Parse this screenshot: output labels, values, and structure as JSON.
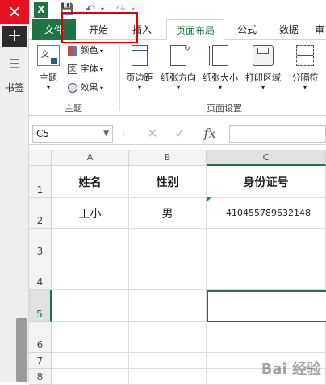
{
  "sidebar": {
    "close": "✕",
    "plus": "+",
    "menu": "☰",
    "bookmark": "书签"
  },
  "qat": {
    "excel": "X",
    "save": "💾",
    "undo": "↶",
    "redo": "↷"
  },
  "tabs": {
    "file": "文件",
    "home": "开始",
    "insert": "插入",
    "page_layout": "页面布局",
    "formulas": "公式",
    "data": "数据",
    "review": "审"
  },
  "ribbon": {
    "theme": "主题",
    "colors": "颜色",
    "fonts": "字体",
    "effects": "效果",
    "margins": "页边距",
    "orientation": "纸张方向",
    "size": "纸张大小",
    "print_area": "打印区域",
    "breaks": "分隔符",
    "group_theme": "主题",
    "group_page_setup": "页面设置"
  },
  "formula_bar": {
    "name_box": "C5",
    "cancel": "✕",
    "enter": "✓",
    "fx": "fx"
  },
  "sheet": {
    "columns": [
      "A",
      "B",
      "C"
    ],
    "rows": [
      "1",
      "2",
      "3",
      "4",
      "5",
      "6",
      "7",
      "8"
    ],
    "cells": {
      "A1": "姓名",
      "B1": "性别",
      "C1": "身份证号",
      "A2": "王小",
      "B2": "男",
      "C2": "410455789632148"
    }
  },
  "watermark": "Bai 经验"
}
